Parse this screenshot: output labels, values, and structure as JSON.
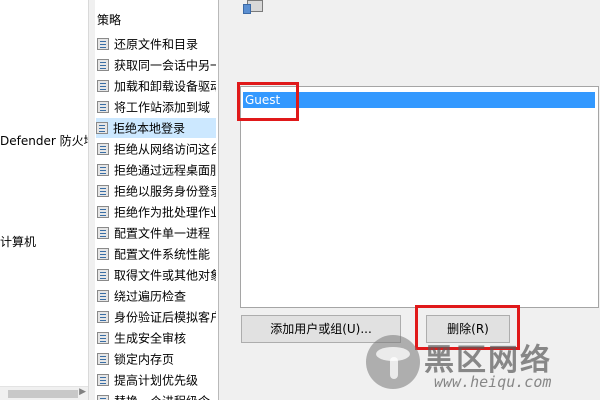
{
  "tree": {
    "item_defender": "Defender 防火墙",
    "item_computer": "计算机"
  },
  "policy_list": {
    "header": "策略",
    "items": [
      "还原文件和目录",
      "获取同一会话中另一",
      "加载和卸载设备驱动",
      "将工作站添加到域",
      "拒绝本地登录",
      "拒绝从网络访问这台",
      "拒绝通过远程桌面服",
      "拒绝以服务身份登录",
      "拒绝作为批处理作业",
      "配置文件单一进程",
      "配置文件系统性能",
      "取得文件或其他对象",
      "绕过遍历检查",
      "身份验证后模拟客户",
      "生成安全审核",
      "锁定内存页",
      "提高计划优先级",
      "替换一个进程级令"
    ],
    "selected_index": 4
  },
  "dialog": {
    "users": [
      "Guest"
    ],
    "add_button": "添加用户或组(U)...",
    "remove_button": "删除(R)"
  },
  "watermark": {
    "brand": "黑区网络",
    "url": "www.heiqu.com"
  },
  "colors": {
    "selection": "#3399ff",
    "highlight_box": "#e0191a",
    "row_selected": "#cce8ff"
  }
}
